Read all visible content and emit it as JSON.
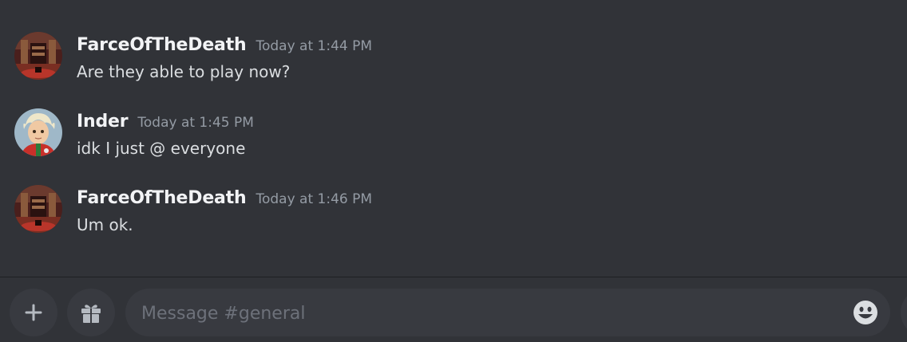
{
  "partial_message": {
    "text": "ok"
  },
  "messages": [
    {
      "username": "FarceOfTheDeath",
      "timestamp": "Today at 1:44 PM",
      "content": "Are they able to play now?",
      "avatar": "farce-avatar"
    },
    {
      "username": "Inder",
      "timestamp": "Today at 1:45 PM",
      "content": "idk I just @ everyone",
      "avatar": "inder-avatar"
    },
    {
      "username": "FarceOfTheDeath",
      "timestamp": "Today at 1:46 PM",
      "content": "Um ok.",
      "avatar": "farce-avatar"
    }
  ],
  "composer": {
    "placeholder": "Message #general",
    "value": ""
  },
  "icons": {
    "add": "plus-icon",
    "gift": "gift-icon",
    "emoji": "smiley-icon"
  },
  "colors": {
    "background": "#313338",
    "input_background": "#383a40",
    "username": "#f2f3f5",
    "timestamp": "#949ba4",
    "text": "#dbdee1"
  }
}
